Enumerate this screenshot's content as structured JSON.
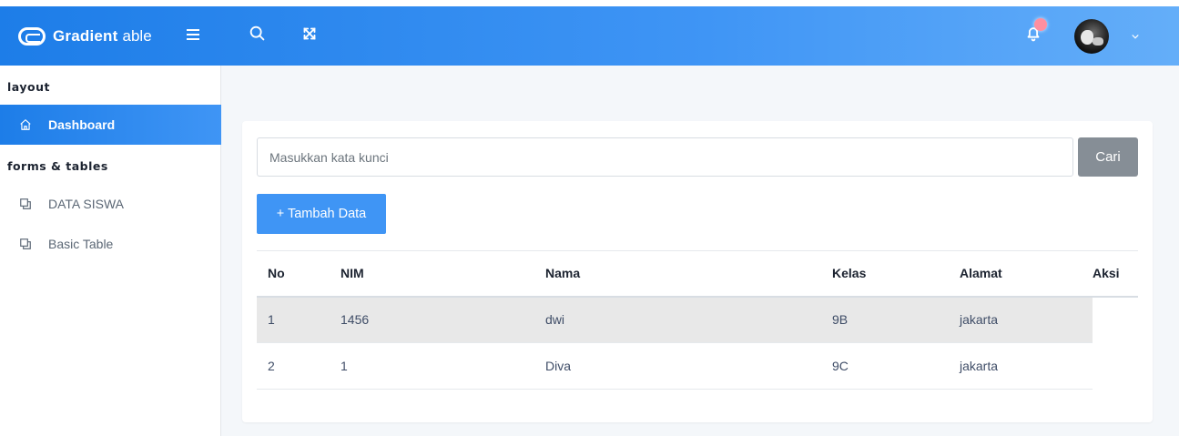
{
  "header": {
    "brand_name": "Gradient",
    "brand_sub": "able"
  },
  "sidebar": {
    "caption_layout": "layout",
    "caption_forms": "forms & tables",
    "items": [
      {
        "label": "Dashboard",
        "icon": "home-icon",
        "active": true
      },
      {
        "label": "DATA SISWA",
        "icon": "layers-icon",
        "active": false
      },
      {
        "label": "Basic Table",
        "icon": "layers-icon",
        "active": false
      }
    ]
  },
  "search": {
    "placeholder": "Masukkan kata kunci",
    "button_label": "Cari"
  },
  "add_button_label": "+ Tambah Data",
  "table": {
    "headers": [
      "No",
      "NIM",
      "Nama",
      "Kelas",
      "Alamat",
      "Aksi"
    ],
    "rows": [
      [
        "1",
        "1456",
        "dwi",
        "9B",
        "jakarta",
        ""
      ],
      [
        "2",
        "1",
        "Diva",
        "9C",
        "jakarta",
        ""
      ]
    ]
  },
  "colors": {
    "accent": "#3f95f5",
    "header_gradient_start": "#1d7de8",
    "header_gradient_end": "#64aef9",
    "search_button": "#868e96",
    "highlight_row": "#e8e8e8"
  }
}
